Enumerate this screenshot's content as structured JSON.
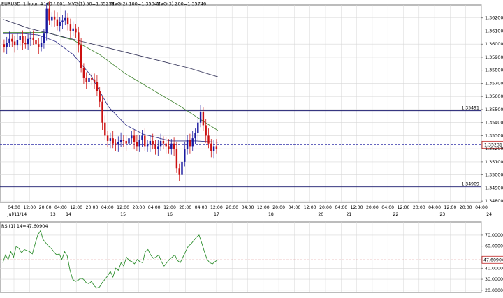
{
  "header": {
    "symbol": "EURUSD",
    "timeframe": "1 hour",
    "bars": "#163 / 601",
    "mva1": "MVG(1) 50=1.35251",
    "mva2": "MVG(2) 100=1.35342",
    "mva3": "MVG(3) 200=1.35746"
  },
  "rsi_header": "RSI(1) 14=47.60904",
  "colors": {
    "bull": "#1a1aa0",
    "bear": "#cc1010",
    "ma50": "#33338a",
    "ma100": "#4a8a3a",
    "ma200": "#35355a",
    "rsi": "#2f8f2f",
    "hline": "#1a1a6e",
    "dash_current": "#3333aa",
    "dash_rsi": "#c02020",
    "grid": "#d7d7d7"
  },
  "chart_data": [
    {
      "type": "candlestick",
      "title": "EURUSD , 1 hour",
      "ylim": [
        1.3479,
        1.363
      ],
      "y_ticks": [
        "1.36200",
        "1.36100",
        "1.36000",
        "1.35900",
        "1.35800",
        "1.35700",
        "1.35600",
        "1.35500",
        "1.35400",
        "1.35300",
        "1.35200",
        "1.35100",
        "1.35000",
        "1.34900",
        "1.34800"
      ],
      "x_time_ticks": [
        "04:00",
        "12:00",
        "20:00",
        "04:00",
        "12:00",
        "20:00",
        "04:00",
        "12:00",
        "20:00",
        "04:00",
        "12:00",
        "20:00",
        "04:00",
        "12:00",
        "20:00",
        "04:00",
        "12:00",
        "20:00",
        "04:00",
        "12:00",
        "20:00",
        "04:00",
        "12:00",
        "20:00",
        "04:00",
        "12:00",
        "20:00",
        "04:00",
        "12:00",
        "20:00",
        "04:00"
      ],
      "x_day_ticks": [
        "Jul/11/14",
        "13",
        "14",
        "15",
        "16",
        "17",
        "18",
        "20",
        "21",
        "22",
        "23",
        "24"
      ],
      "close_series": [
        1.3598,
        1.3601,
        1.3604,
        1.3602,
        1.3599,
        1.3603,
        1.3606,
        1.3601,
        1.36,
        1.3604,
        1.3605,
        1.3603,
        1.36,
        1.3598,
        1.3601,
        1.3608,
        1.3627,
        1.3618,
        1.3621,
        1.3619,
        1.3614,
        1.3617,
        1.3618,
        1.362,
        1.3615,
        1.361,
        1.3612,
        1.3609,
        1.3599,
        1.3582,
        1.3574,
        1.3571,
        1.3574,
        1.3573,
        1.3571,
        1.3564,
        1.3556,
        1.354,
        1.353,
        1.3526,
        1.3528,
        1.3524,
        1.3523,
        1.3525,
        1.3527,
        1.3526,
        1.3524,
        1.3528,
        1.353,
        1.3525,
        1.3522,
        1.3527,
        1.353,
        1.3522,
        1.3523,
        1.3526,
        1.3523,
        1.352,
        1.3522,
        1.3526,
        1.3524,
        1.3522,
        1.352,
        1.3524,
        1.352,
        1.3505,
        1.35,
        1.351,
        1.352,
        1.3527,
        1.3522,
        1.3528,
        1.3532,
        1.354,
        1.3548,
        1.3538,
        1.353,
        1.3524,
        1.3518,
        1.3522,
        1.352
      ],
      "levels": [
        {
          "label": "1.35491",
          "value": 1.35491
        },
        {
          "label": "1.34909",
          "value": 1.34909
        }
      ],
      "current_level": {
        "label": "1.35231",
        "value": 1.35231
      },
      "moving_averages": [
        {
          "name": "MVG(1) 50",
          "points": [
            [
              0,
              1.3608
            ],
            [
              12,
              1.3608
            ],
            [
              20,
              1.3607
            ],
            [
              30,
              1.3602
            ],
            [
              40,
              1.3592
            ],
            [
              50,
              1.3576
            ],
            [
              60,
              1.3552
            ],
            [
              70,
              1.3538
            ],
            [
              80,
              1.3531
            ],
            [
              95,
              1.3526
            ],
            [
              110,
              1.3526
            ],
            [
              122,
              1.3525
            ]
          ]
        },
        {
          "name": "MVG(2) 100",
          "points": [
            [
              0,
              1.3609
            ],
            [
              12,
              1.3609
            ],
            [
              25,
              1.3609
            ],
            [
              40,
              1.3603
            ],
            [
              55,
              1.3592
            ],
            [
              70,
              1.3577
            ],
            [
              85,
              1.3565
            ],
            [
              100,
              1.3553
            ],
            [
              115,
              1.354
            ],
            [
              122,
              1.3534
            ]
          ]
        },
        {
          "name": "MVG(3) 200",
          "points": [
            [
              0,
              1.3619
            ],
            [
              15,
              1.3612
            ],
            [
              30,
              1.3607
            ],
            [
              45,
              1.3602
            ],
            [
              60,
              1.3597
            ],
            [
              75,
              1.3592
            ],
            [
              90,
              1.3587
            ],
            [
              105,
              1.3582
            ],
            [
              122,
              1.3575
            ]
          ]
        }
      ],
      "grid": true
    },
    {
      "type": "line",
      "title": "RSI(1) 14=47.60904",
      "ylim": [
        18,
        82
      ],
      "y_ticks": [
        "70.00000",
        "60.00000",
        "40.00000",
        "30.00000",
        "20.00000"
      ],
      "current_level": {
        "label": "47.60904",
        "value": 47.60904
      },
      "series": [
        {
          "values": [
            45,
            52,
            48,
            55,
            50,
            60,
            58,
            54,
            57,
            56,
            55,
            53,
            62,
            70,
            74,
            66,
            63,
            60,
            58,
            55,
            52,
            53,
            48,
            55,
            51,
            38,
            30,
            28,
            29,
            31,
            30,
            27,
            26,
            28,
            24,
            22,
            23,
            27,
            30,
            33,
            37,
            32,
            40,
            38,
            45,
            42,
            50,
            47,
            46,
            44,
            48,
            46,
            45,
            55,
            57,
            52,
            49,
            50,
            52,
            46,
            42,
            45,
            48,
            50,
            52,
            47,
            45,
            50,
            55,
            60,
            62,
            65,
            68,
            70,
            63,
            55,
            48,
            45,
            44,
            46,
            47.6
          ]
        }
      ],
      "grid": true
    }
  ]
}
